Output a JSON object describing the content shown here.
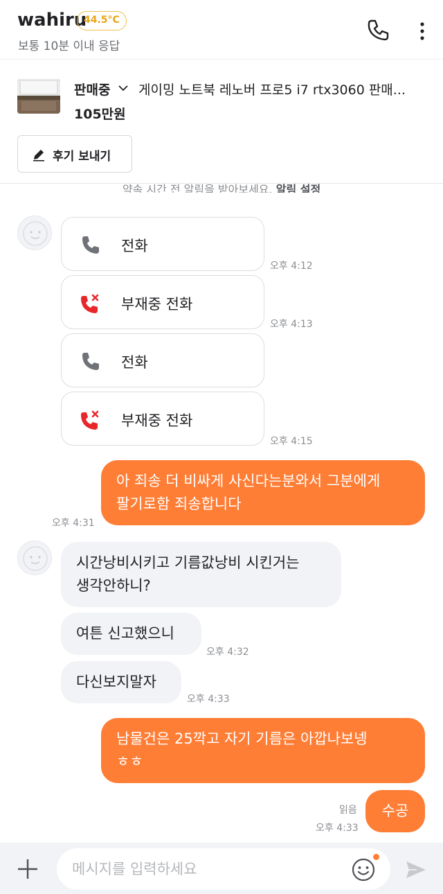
{
  "header": {
    "seller_name": "wahiru",
    "manner_temp": "44.5°C",
    "response_time": "보통 10분 이내 응답"
  },
  "product": {
    "status": "판매중",
    "title": "게이밍 노트북 레노버 프로5 i7 rtx3060 판매...",
    "price": "105만원",
    "review_button": "후기 보내기"
  },
  "notice": {
    "text": "약속 시간 전 알림을 받아보세요.",
    "link": "알림 설정"
  },
  "messages": {
    "call1": {
      "label": "전화",
      "time": "오후 4:12"
    },
    "call2": {
      "label": "부재중 전화",
      "time": "오후 4:13"
    },
    "call3": {
      "label": "전화",
      "time": ""
    },
    "call4": {
      "label": "부재중 전화",
      "time": "오후 4:15"
    },
    "out1": {
      "lines": [
        "아 죄송 더 비싸게 사신다는분와서 그분에게",
        "팔기로함 죄송합니다"
      ],
      "time": "오후 4:31"
    },
    "in1": {
      "lines": [
        "시간낭비시키고 기름값낭비 시킨거는",
        "생각안하니?"
      ]
    },
    "in2": {
      "text": "여튼 신고했으니",
      "time": "오후 4:32"
    },
    "in3": {
      "text": "다신보지말자",
      "time": "오후 4:33"
    },
    "out2": {
      "lines": [
        "남물건은 25깍고 자기 기름은 아깝나보넹",
        "ㅎㅎ"
      ]
    },
    "out3": {
      "text": "수공",
      "read": "읽음",
      "time": "오후 4:33"
    }
  },
  "input": {
    "placeholder": "메시지를 입력하세요"
  },
  "colors": {
    "brand_orange": "#ff7e36",
    "missed_call_red": "#e8272b",
    "temp_yellow": "#e8a518"
  },
  "icons": [
    "phone-icon",
    "more-vertical-icon",
    "chevron-down-icon",
    "pencil-icon",
    "missed-call-icon",
    "plus-icon",
    "emoji-icon",
    "send-icon"
  ]
}
